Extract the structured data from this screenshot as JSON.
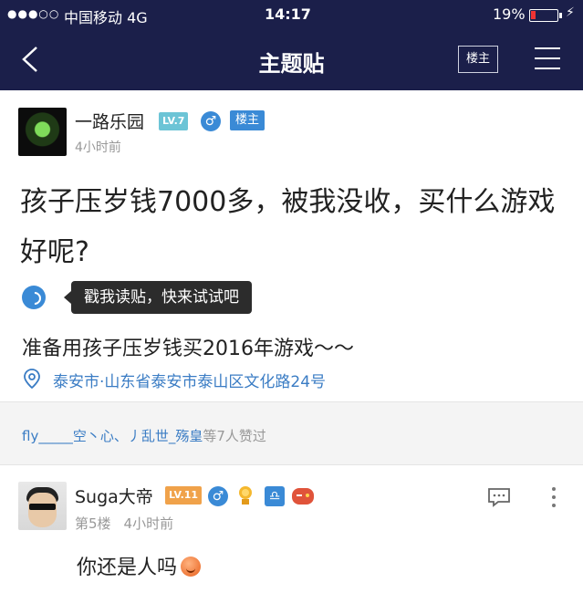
{
  "status_bar": {
    "signal": "●●●○○",
    "carrier": "中国移动  4G",
    "time": "14:17",
    "battery_percent": "19%",
    "battery_level": 0.19,
    "charging_glyph": "⚡"
  },
  "navbar": {
    "title": "主题贴",
    "owner_button": "楼主",
    "icons": [
      "chevron-left-icon",
      "menu-icon"
    ]
  },
  "post": {
    "author": "一路乐园",
    "level_badge": "LV.7",
    "gender_glyph": "♂",
    "owner_tag": "楼主",
    "time": "4小时前",
    "title": "孩子压岁钱7000多，被我没收，买什么游戏好呢?",
    "voice_tooltip": "戳我读贴，快来试试吧",
    "body": "准备用孩子压岁钱买2016年游戏～～",
    "location": "泰安市·山东省泰安市泰山区文化路24号"
  },
  "likes": {
    "users": "fly_____空丶心、丿乱世_殇皇",
    "count_text": "等7人赞过"
  },
  "reply": {
    "author": "Suga大帝",
    "level_badge": "LV.11",
    "gender_glyph": "♂",
    "libra_glyph": "♎",
    "floor": "第5楼",
    "time": "4小时前",
    "text": "你还是人吗"
  },
  "colors": {
    "header_bg": "#1b1f4a",
    "accent_blue": "#3a8ad6",
    "link_blue": "#3a7cc4",
    "battery_low": "#ee3333"
  }
}
